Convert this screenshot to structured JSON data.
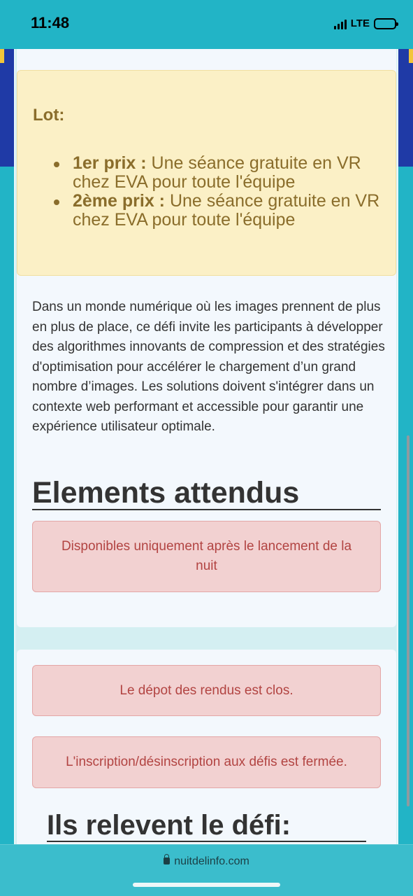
{
  "status_bar": {
    "time": "11:48",
    "network": "LTE"
  },
  "prize": {
    "title": "Lot:",
    "items": [
      {
        "rank": "1er prix :",
        "text": " Une séance gratuite en VR chez EVA pour toute l'équipe"
      },
      {
        "rank": "2ème prix :",
        "text": " Une séance gratuite en VR chez EVA pour toute l'équipe"
      }
    ]
  },
  "description": "Dans un monde numérique où les images prennent de plus en plus de place, ce défi invite les participants à développer des algorithmes innovants de compression et des stratégies d'optimisation pour accélérer le chargement d’un grand nombre d’images. Les solutions doivent s'intégrer dans un contexte web performant et accessible pour garantir une expérience utilisateur optimale.",
  "expected": {
    "heading": "Elements attendus",
    "notice": "Disponibles uniquement après le lancement de la nuit"
  },
  "status": {
    "submissions_closed": "Le dépot des rendus est clos.",
    "registration_closed": "L'inscription/désinscription aux défis est fermée."
  },
  "participants": {
    "heading": "Ils relevent le défi:"
  },
  "browser": {
    "url": "nuitdelinfo.com"
  }
}
